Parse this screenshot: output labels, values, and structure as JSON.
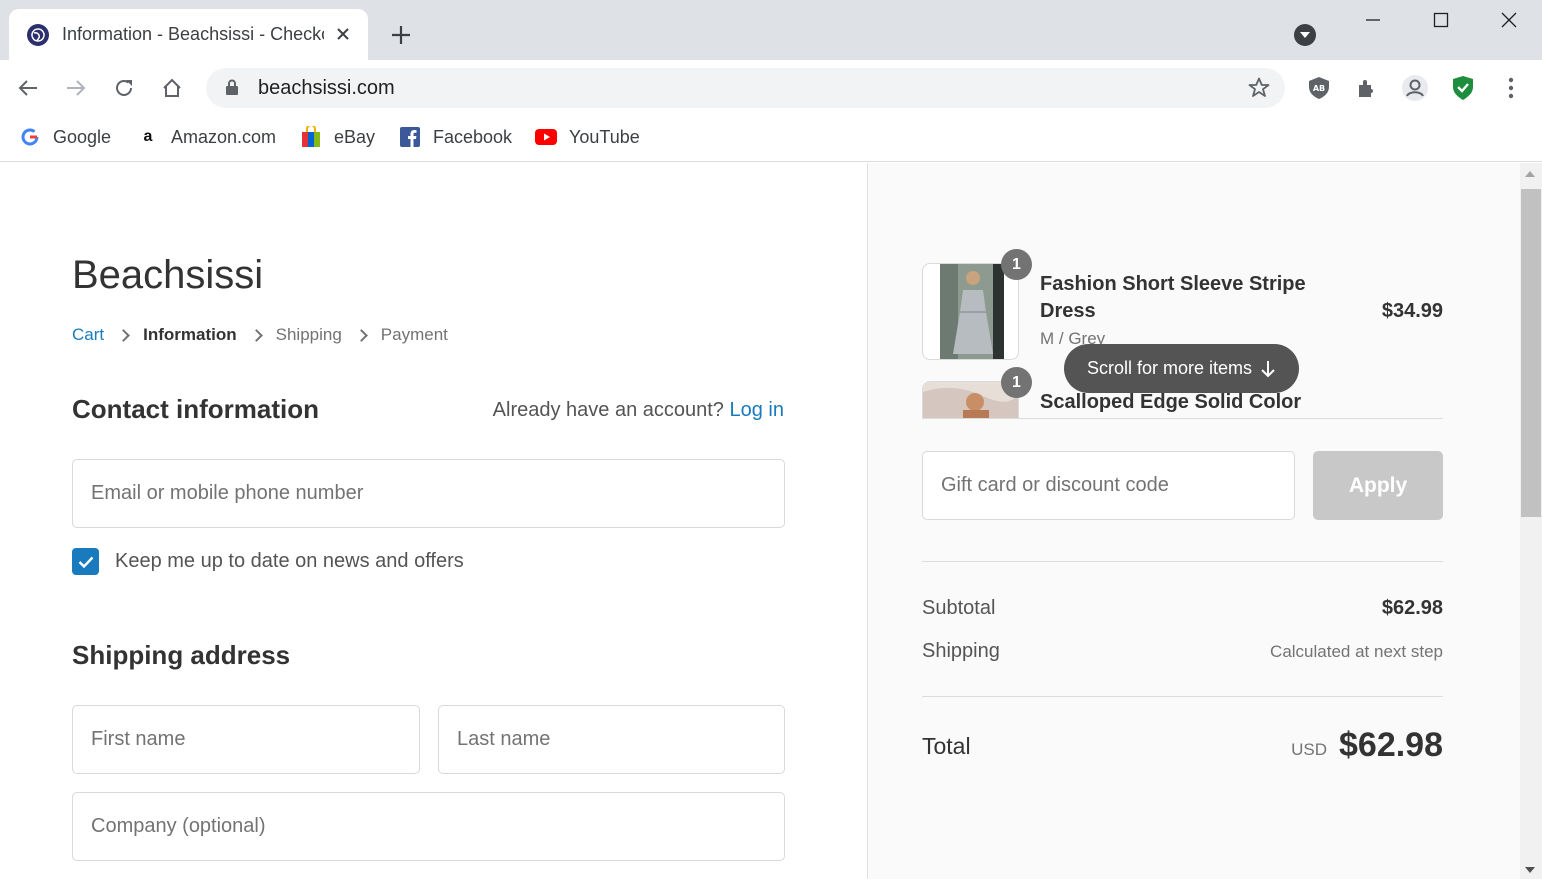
{
  "browser": {
    "tab_title": "Information - Beachsissi - Checkout",
    "url": "beachsissi.com",
    "bookmarks": [
      "Google",
      "Amazon.com",
      "eBay",
      "Facebook",
      "YouTube"
    ]
  },
  "shop": {
    "name": "Beachsissi"
  },
  "breadcrumb": [
    "Cart",
    "Information",
    "Shipping",
    "Payment"
  ],
  "contact": {
    "title": "Contact information",
    "account_prompt": "Already have an account?",
    "login_link": "Log in",
    "email_placeholder": "Email or mobile phone number",
    "newsletter_label": "Keep me up to date on news and offers",
    "newsletter_checked": true
  },
  "shipping": {
    "title": "Shipping address",
    "first_name_placeholder": "First name",
    "last_name_placeholder": "Last name",
    "company_placeholder": "Company (optional)"
  },
  "order": {
    "items": [
      {
        "quantity": "1",
        "name": "Fashion Short Sleeve Stripe Dress",
        "variant": "M / Grey",
        "price": "$34.99"
      },
      {
        "quantity": "1",
        "name": "Scalloped Edge Solid Color Bikini Set",
        "variant": "",
        "price": ""
      }
    ],
    "scroll_hint": "Scroll for more items",
    "discount_placeholder": "Gift card or discount code",
    "apply_label": "Apply",
    "subtotal_label": "Subtotal",
    "subtotal_value": "$62.98",
    "shipping_label": "Shipping",
    "shipping_value": "Calculated at next step",
    "total_label": "Total",
    "total_currency": "USD",
    "total_value": "$62.98"
  },
  "colors": {
    "link": "#197bbd",
    "apply_disabled": "#c8c8c8",
    "hint_bg": "#545454"
  }
}
